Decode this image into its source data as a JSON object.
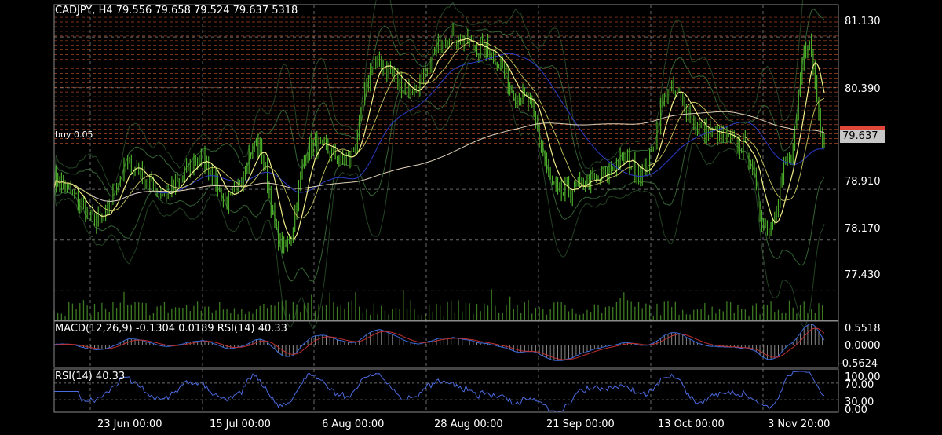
{
  "header": {
    "symbol_line": "CADJPY, H4  79.556 79.658 79.524 79.637 5318"
  },
  "current_price": "79.637",
  "price_axis_labels": [
    "81.130",
    "80.390",
    "78.910",
    "78.170",
    "77.430"
  ],
  "time_axis_labels": [
    "23 Jun 00:00",
    "15 Jul 00:00",
    "6 Aug 00:00",
    "28 Aug 00:00",
    "21 Sep 00:00",
    "13 Oct 00:00",
    "3 Nov 20:00"
  ],
  "macd": {
    "label": "MACD(12,26,9)  -0.1304 0.0189 RSI(14) 40.33",
    "axis_labels": [
      "0.5518",
      "0.0000",
      "-0.5624"
    ]
  },
  "rsi": {
    "label": "RSI(14)  40.33",
    "axis_labels": [
      "100.00",
      "70.00",
      "30.00",
      "0.00"
    ]
  },
  "order_label": "buy 0.05",
  "colors": {
    "background": "#000000",
    "candles": "#4caf2a",
    "ma_fast": "#f2f08a",
    "ma_slow": "#e0d0b8",
    "bands": "#3a6e3a",
    "blue_ma": "#2a3cc8",
    "order_lines": "#c0502a",
    "grid": "#6a6a6a",
    "volume": "#3d7a22",
    "macd_hist": "#8a8a8a",
    "macd_signal": "#c03030",
    "macd_main": "#3a6ad8",
    "rsi_line": "#4a6ae0"
  },
  "chart_data": [
    {
      "type": "line",
      "title": "CADJPY, H4",
      "x": [
        "23 Jun 00:00",
        "15 Jul 00:00",
        "6 Aug 00:00",
        "28 Aug 00:00",
        "21 Sep 00:00",
        "13 Oct 00:00",
        "3 Nov 20:00"
      ],
      "series": [
        {
          "values": [
            78.2,
            79.4,
            79.3,
            81.2,
            78.9,
            80.4,
            79.637
          ]
        }
      ],
      "ylim": [
        77.0,
        81.6
      ],
      "grid": true
    },
    {
      "type": "line",
      "title": "MACD(12,26,9)",
      "ylim": [
        -0.5624,
        0.5518
      ],
      "series": [
        {
          "values": [
            -0.1304
          ]
        },
        {
          "values": [
            0.0189
          ]
        }
      ]
    },
    {
      "type": "line",
      "title": "RSI(14)",
      "ylim": [
        0,
        100
      ],
      "series": [
        {
          "values": [
            40.33
          ]
        }
      ]
    }
  ]
}
